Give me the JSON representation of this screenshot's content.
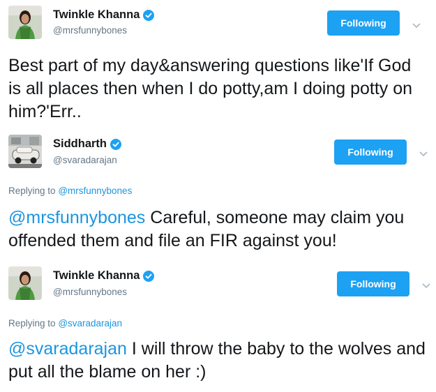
{
  "tweets": [
    {
      "name": "Twinkle Khanna",
      "handle": "@mrsfunnybones",
      "follow_label": "Following",
      "text": "Best part of my day&answering questions like'If God is all places then when I do potty,am I doing potty on him?'Err.."
    },
    {
      "name": "Siddharth",
      "handle": "@svaradarajan",
      "follow_label": "Following",
      "replying_prefix": "Replying to",
      "replying_handle": "@mrsfunnybones",
      "mention": "@mrsfunnybones",
      "text": " Careful, someone may claim you offended them and file an FIR against you!"
    },
    {
      "name": "Twinkle Khanna",
      "handle": "@mrsfunnybones",
      "follow_label": "Following",
      "replying_prefix": "Replying to",
      "replying_handle": "@svaradarajan",
      "mention": "@svaradarajan",
      "text": " I will throw the baby to the wolves and put all the blame on her :)"
    }
  ],
  "colors": {
    "accent": "#1da1f2",
    "link": "#1b95e0",
    "muted": "#657786",
    "text": "#14171a"
  },
  "icons": [
    "verified-badge-icon",
    "chevron-down-icon"
  ]
}
